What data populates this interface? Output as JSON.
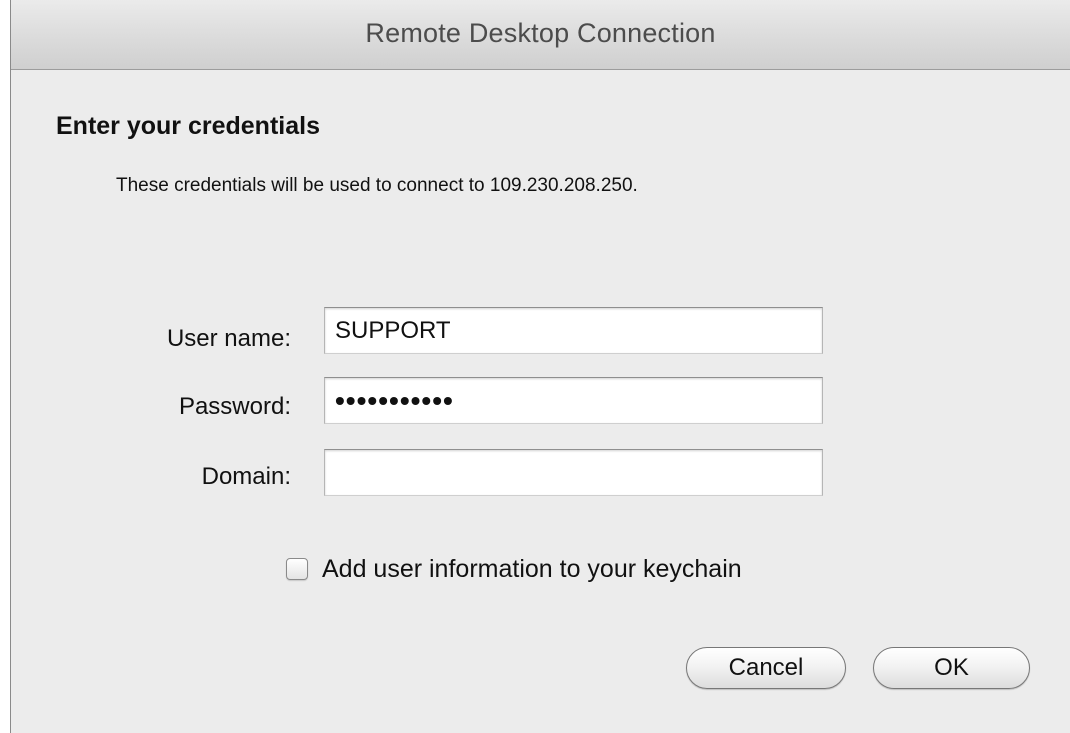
{
  "window": {
    "title": "Remote Desktop Connection"
  },
  "dialog": {
    "heading": "Enter your credentials",
    "description": "These credentials will be used to connect to 109.230.208.250."
  },
  "form": {
    "username": {
      "label": "User name:",
      "value": "SUPPORT"
    },
    "password": {
      "label": "Password:",
      "value": "•••••••••••"
    },
    "domain": {
      "label": "Domain:",
      "value": ""
    }
  },
  "keychain": {
    "label": "Add user information to your keychain",
    "checked": false
  },
  "buttons": {
    "cancel": "Cancel",
    "ok": "OK"
  }
}
